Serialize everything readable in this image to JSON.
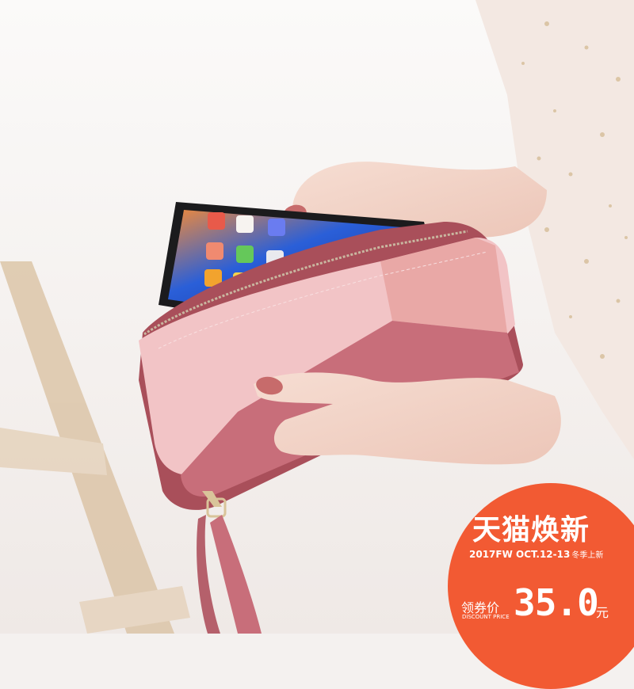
{
  "promo": {
    "title": "天猫焕新",
    "event_line": "2017FW OCT.12-13",
    "season": "冬季上新",
    "price_prefix": "领券价",
    "price_caption": "DISCOUNT PRICE",
    "price": "35.0",
    "currency": "元",
    "badge_color": "#f25a33"
  },
  "product": {
    "wallet_colors": [
      "#f2c4c6",
      "#c86e7a",
      "#e9a8a6"
    ]
  }
}
